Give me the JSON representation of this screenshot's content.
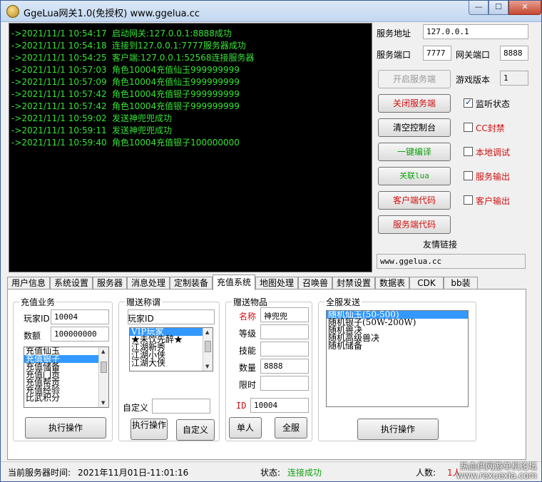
{
  "window": {
    "title": "GgeLua网关1.0(免授权) www.ggelua.cc",
    "min_glyph": "—",
    "max_glyph": "☐",
    "close_glyph": "✕"
  },
  "console": {
    "lines": [
      {
        "ts": "->2021/11/1 10:54:17",
        "msg": "启动网关:127.0.0.1:8888成功"
      },
      {
        "ts": "->2021/11/1 10:54:18",
        "msg": "连接到127.0.0.1:7777服务器成功"
      },
      {
        "ts": "->2021/11/1 10:54:25",
        "msg": "客户端:127.0.0.1:52568连接服务器"
      },
      {
        "ts": "->2021/11/1 10:57:03",
        "msg": "角色10004充值仙玉999999999"
      },
      {
        "ts": "->2021/11/1 10:57:09",
        "msg": "角色10004充值仙玉999999999"
      },
      {
        "ts": "->2021/11/1 10:57:42",
        "msg": "角色10004充值银子999999999"
      },
      {
        "ts": "->2021/11/1 10:57:42",
        "msg": "角色10004充值银子999999999"
      },
      {
        "ts": "->2021/11/1 10:59:02",
        "msg": "发送神兜兜成功"
      },
      {
        "ts": "->2021/11/1 10:59:11",
        "msg": "发送神兜兜成功"
      },
      {
        "ts": "->2021/11/1 10:59:40",
        "msg": "角色10004充值银子100000000"
      }
    ]
  },
  "server": {
    "address_label": "服务地址",
    "address_value": "127.0.0.1",
    "port_label": "服务端口",
    "port_value": "7777",
    "gateway_port_label": "网关端口",
    "gateway_port_value": "8888",
    "start_button": "开启服务端",
    "game_version_label": "游戏版本",
    "game_version_value": "1",
    "close_button": "关闭服务端",
    "clear_button": "清空控制台",
    "compile_button": "一键编译",
    "lua_button": "关联lua",
    "client_code_button": "客户端代码",
    "server_code_button": "服务端代码",
    "chk_monitor": "监听状态",
    "chk_cc": "CC封禁",
    "chk_debug": "本地调试",
    "chk_server_out": "服务输出",
    "chk_client_out": "客户输出",
    "friend_link_label": "友情链接",
    "friend_link_value": "www.ggelua.cc"
  },
  "tabs": [
    {
      "label": "用户信息"
    },
    {
      "label": "系统设置"
    },
    {
      "label": "服务器"
    },
    {
      "label": "消息处理"
    },
    {
      "label": "定制装备"
    },
    {
      "label": "充值系统"
    },
    {
      "label": "地图处理"
    },
    {
      "label": "召唤兽"
    },
    {
      "label": "封禁设置"
    },
    {
      "label": "数据表"
    },
    {
      "label": "CDK"
    },
    {
      "label": "bb装"
    }
  ],
  "recharge": {
    "title": "充值业务",
    "player_id_label": "玩家ID",
    "player_id_value": "10004",
    "amount_label": "数额",
    "amount_value": "100000000",
    "items": [
      "充值仙玉",
      "充值银子",
      "充值储备",
      "充值门贡",
      "充值帮贡",
      "充值经验",
      "比武积分"
    ],
    "selected": "充值银子",
    "execute": "执行操作"
  },
  "title_gift": {
    "title": "赠送称谓",
    "player_id_label": "玩家ID",
    "items": [
      "VIP玩家",
      "★未饮先醉★",
      "江湖新秀",
      "江湖小侠",
      "江湖大侠"
    ],
    "selected": "VIP玩家",
    "custom_label": "自定义",
    "execute": "执行操作",
    "custom_button": "自定义"
  },
  "item_gift": {
    "title": "赠送物品",
    "name_label": "名称",
    "name_value": "神兜兜",
    "level_label": "等级",
    "skill_label": "技能",
    "count_label": "数量",
    "count_value": "8888",
    "limit_label": "限时",
    "id_label": "ID",
    "id_value": "10004",
    "single_button": "单人",
    "all_button": "全服"
  },
  "broadcast": {
    "title": "全服发送",
    "items": [
      "随机仙玉(50-500)",
      "随机银子(50W-200W)",
      "随机兽决",
      "随机高级兽决",
      "随机储备"
    ],
    "selected": "随机仙玉(50-500)",
    "execute": "执行操作"
  },
  "status": {
    "time_label": "当前服务器时间:",
    "time_value": "2021年11月01日-11:01:16",
    "state_label": "状态:",
    "state_value": "连接成功",
    "count_label": "人数:",
    "count_value": "1人",
    "watermark_line1": "热血供网游单机论坛",
    "watermark_line2": "www.rexuexia.com"
  },
  "colors": {
    "console_text": "#36e236",
    "accent_red": "#d01010",
    "accent_green": "#10a010",
    "selection": "#3399ff"
  }
}
